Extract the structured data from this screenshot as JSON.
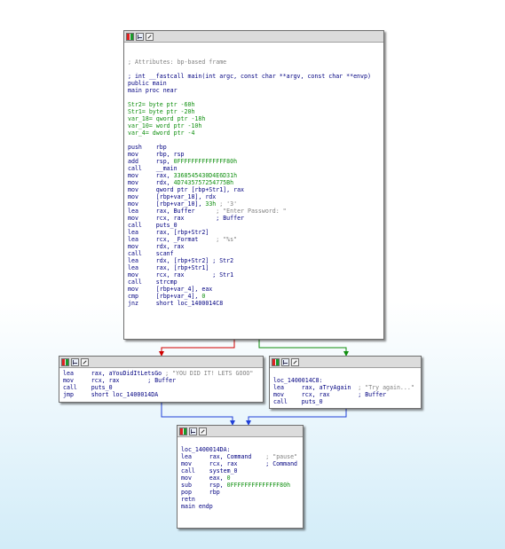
{
  "edge_colors": {
    "false_branch": "#d00000",
    "true_branch": "#0f8f0f",
    "unconditional": "#2040d8"
  },
  "nodes": [
    {
      "id": "main",
      "header_icons": [
        "color-icon",
        "graph-icon",
        "zoom-icon"
      ],
      "lines": [
        [
          {
            "t": "",
            "c": "bl"
          }
        ],
        [
          {
            "t": "",
            "c": "bl"
          }
        ],
        [
          {
            "t": "; Attributes: bp-based frame",
            "c": "cm"
          }
        ],
        [
          {
            "t": "",
            "c": "bl"
          }
        ],
        [
          {
            "t": "; int __fastcall main(int argc, const char **argv, const char **envp)",
            "c": "bl"
          }
        ],
        [
          {
            "t": "public main",
            "c": "bl"
          }
        ],
        [
          {
            "t": "main proc near",
            "c": "bl"
          }
        ],
        [
          {
            "t": "",
            "c": "bl"
          }
        ],
        [
          {
            "t": "Str2= byte ptr -60h",
            "c": "gr"
          }
        ],
        [
          {
            "t": "Str1= byte ptr -20h",
            "c": "gr"
          }
        ],
        [
          {
            "t": "var_18= qword ptr -18h",
            "c": "gr"
          }
        ],
        [
          {
            "t": "var_10= word ptr -10h",
            "c": "gr"
          }
        ],
        [
          {
            "t": "var_4= dword ptr -4",
            "c": "gr"
          }
        ],
        [
          {
            "t": "",
            "c": "bl"
          }
        ],
        [
          {
            "t": "push    rbp",
            "c": "bl"
          }
        ],
        [
          {
            "t": "mov     rbp, rsp",
            "c": "bl"
          }
        ],
        [
          {
            "t": "add     rsp, ",
            "c": "bl"
          },
          {
            "t": "0FFFFFFFFFFFFFF80h",
            "c": "gr"
          }
        ],
        [
          {
            "t": "call    __main",
            "c": "bl"
          }
        ],
        [
          {
            "t": "mov     rax, ",
            "c": "bl"
          },
          {
            "t": "3368545430D4E6D31h",
            "c": "gr"
          }
        ],
        [
          {
            "t": "mov     rdx, ",
            "c": "bl"
          },
          {
            "t": "4D7435757254775Bh",
            "c": "gr"
          }
        ],
        [
          {
            "t": "mov     qword ptr [rbp+Str1], rax",
            "c": "bl"
          }
        ],
        [
          {
            "t": "mov     [rbp+var_18], rdx",
            "c": "bl"
          }
        ],
        [
          {
            "t": "mov     [rbp+var_10], ",
            "c": "bl"
          },
          {
            "t": "33h",
            "c": "gr"
          },
          {
            "t": " ; '3'",
            "c": "cm"
          }
        ],
        [
          {
            "t": "lea     rax, Buffer      ",
            "c": "bl"
          },
          {
            "t": "; \"Enter Password: \"",
            "c": "cm"
          }
        ],
        [
          {
            "t": "mov     rcx, rax         ",
            "c": "bl"
          },
          {
            "t": "; Buffer",
            "c": "bl"
          }
        ],
        [
          {
            "t": "call    puts_0",
            "c": "bl"
          }
        ],
        [
          {
            "t": "lea     rax, [rbp+Str2]",
            "c": "bl"
          }
        ],
        [
          {
            "t": "lea     rcx, _Format     ",
            "c": "bl"
          },
          {
            "t": "; \"%s\"",
            "c": "cm"
          }
        ],
        [
          {
            "t": "mov     rdx, rax",
            "c": "bl"
          }
        ],
        [
          {
            "t": "call    scanf",
            "c": "bl"
          }
        ],
        [
          {
            "t": "lea     rdx, [rbp+Str2] ; Str2",
            "c": "bl"
          }
        ],
        [
          {
            "t": "lea     rax, [rbp+Str1]",
            "c": "bl"
          }
        ],
        [
          {
            "t": "mov     rcx, rax        ; Str1",
            "c": "bl"
          }
        ],
        [
          {
            "t": "call    strcmp",
            "c": "bl"
          }
        ],
        [
          {
            "t": "mov     [rbp+var_4], eax",
            "c": "bl"
          }
        ],
        [
          {
            "t": "cmp     [rbp+var_4], ",
            "c": "bl"
          },
          {
            "t": "0",
            "c": "gr"
          }
        ],
        [
          {
            "t": "jnz     short loc_1400014C8",
            "c": "bl"
          }
        ]
      ]
    },
    {
      "id": "success",
      "header_icons": [
        "color-icon",
        "graph-icon",
        "zoom-icon"
      ],
      "lines": [
        [
          {
            "t": "lea     rax, aYouDidItLetsGo ",
            "c": "bl"
          },
          {
            "t": "; \"YOU DID IT! LETS GOOO\"",
            "c": "cm"
          }
        ],
        [
          {
            "t": "mov     rcx, rax        ; Buffer",
            "c": "bl"
          }
        ],
        [
          {
            "t": "call    puts_0",
            "c": "bl"
          }
        ],
        [
          {
            "t": "jmp     short loc_1400014DA",
            "c": "bl"
          }
        ]
      ]
    },
    {
      "id": "failure",
      "header_icons": [
        "color-icon",
        "graph-icon",
        "zoom-icon"
      ],
      "lines": [
        [
          {
            "t": "",
            "c": "bl"
          }
        ],
        [
          {
            "t": "loc_1400014C8:",
            "c": "bl"
          }
        ],
        [
          {
            "t": "lea     rax, aTryAgain  ",
            "c": "bl"
          },
          {
            "t": "; \"Try again...\"",
            "c": "cm"
          }
        ],
        [
          {
            "t": "mov     rcx, rax        ; Buffer",
            "c": "bl"
          }
        ],
        [
          {
            "t": "call    puts_0",
            "c": "bl"
          }
        ]
      ]
    },
    {
      "id": "exit",
      "header_icons": [
        "color-icon",
        "graph-icon",
        "zoom-icon"
      ],
      "lines": [
        [
          {
            "t": "",
            "c": "bl"
          }
        ],
        [
          {
            "t": "loc_1400014DA:",
            "c": "bl"
          }
        ],
        [
          {
            "t": "lea     rax, Command    ",
            "c": "bl"
          },
          {
            "t": "; \"pause\"",
            "c": "cm"
          }
        ],
        [
          {
            "t": "mov     rcx, rax        ; Command",
            "c": "bl"
          }
        ],
        [
          {
            "t": "call    system_0",
            "c": "bl"
          }
        ],
        [
          {
            "t": "mov     eax, ",
            "c": "bl"
          },
          {
            "t": "0",
            "c": "gr"
          }
        ],
        [
          {
            "t": "sub     rsp, ",
            "c": "bl"
          },
          {
            "t": "0FFFFFFFFFFFFFF80h",
            "c": "gr"
          }
        ],
        [
          {
            "t": "pop     rbp",
            "c": "bl"
          }
        ],
        [
          {
            "t": "retn",
            "c": "bl"
          }
        ],
        [
          {
            "t": "main endp",
            "c": "bl"
          }
        ]
      ]
    }
  ]
}
